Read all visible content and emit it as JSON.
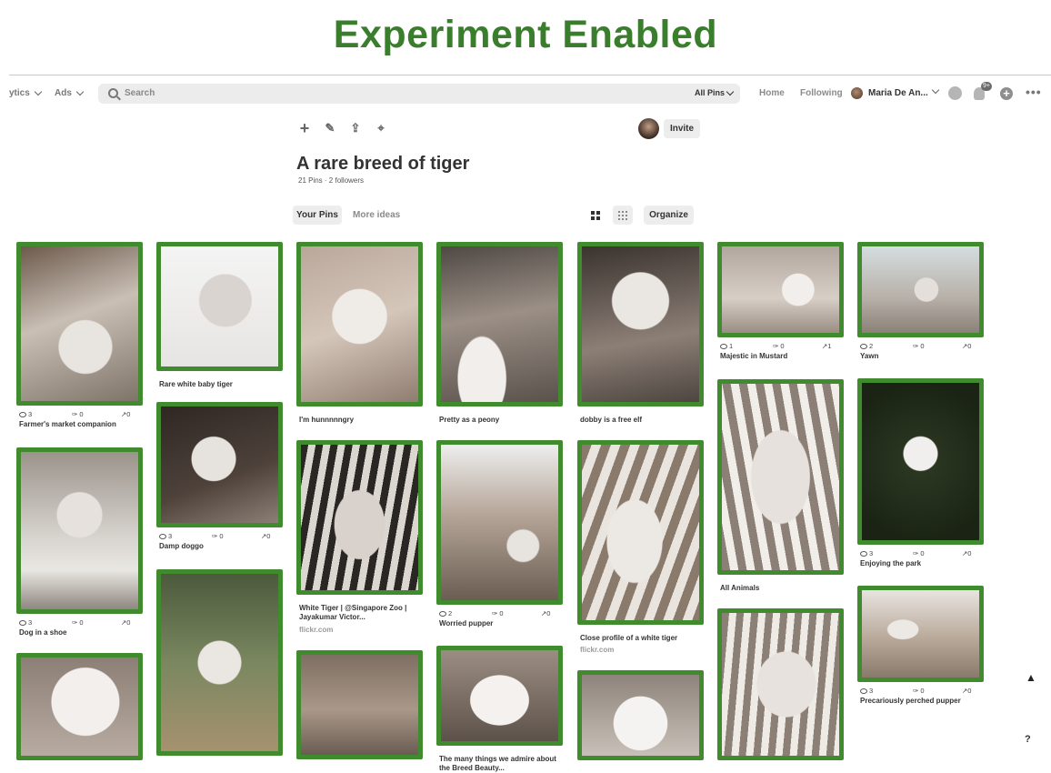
{
  "banner": {
    "title": "Experiment Enabled"
  },
  "nav": {
    "analytics_label": "ytics",
    "ads_label": "Ads",
    "search_placeholder": "Search",
    "scope_label": "All Pins",
    "home_label": "Home",
    "following_label": "Following",
    "user_name": "Maria De An...",
    "notification_count": "9+",
    "more_label": "•••"
  },
  "board": {
    "title": "A rare breed of tiger",
    "meta": "21 Pins · 2 followers",
    "invite_label": "Invite",
    "tabs": {
      "your_pins": "Your Pins",
      "more_ideas": "More ideas"
    },
    "organize_label": "Organize",
    "tools": [
      "plus-icon",
      "pencil-icon",
      "share-icon",
      "focus-icon"
    ]
  },
  "accent": "#3f8b2d",
  "pins": [
    {
      "title": "Farmer's market companion",
      "views": "3",
      "saves": "0",
      "clicks": "0",
      "image": "dog-held"
    },
    {
      "title": "Dog in a shoe",
      "views": "3",
      "saves": "0",
      "clicks": "0",
      "image": "dog-shoe"
    },
    {
      "title": "",
      "image": "dog-closeup"
    },
    {
      "title": "Rare white baby tiger",
      "image": "white-cub"
    },
    {
      "title": "Damp doggo",
      "views": "3",
      "saves": "0",
      "clicks": "0",
      "image": "dog-dark"
    },
    {
      "title": "",
      "image": "cub-grass"
    },
    {
      "title": "I'm hunnnnngry",
      "image": "dog-tiles"
    },
    {
      "title": "White Tiger | @Singapore Zoo | Jayakumar Victor...",
      "source": "flickr.com",
      "image": "tiger-face"
    },
    {
      "title": "",
      "image": "laptop"
    },
    {
      "title": "Pretty as a peony",
      "image": "dog-rocks"
    },
    {
      "title": "Worried pupper",
      "views": "2",
      "saves": "0",
      "clicks": "0",
      "image": "wagon"
    },
    {
      "title": "The many things we admire about the Breed Beauty...",
      "image": "puppies"
    },
    {
      "title": "dobby is a free elf",
      "image": "dog-blanket"
    },
    {
      "title": "Close profile of a white tiger",
      "source": "flickr.com",
      "image": "tiger-profile"
    },
    {
      "title": "",
      "image": "flower"
    },
    {
      "title": "Majestic in Mustard",
      "views": "1",
      "saves": "0",
      "clicks": "1",
      "image": "dog-bed"
    },
    {
      "title": "All Animals",
      "image": "tiger-roar"
    },
    {
      "title": "",
      "image": "tiger-sitting"
    },
    {
      "title": "Yawn",
      "views": "2",
      "saves": "0",
      "clicks": "0",
      "image": "street"
    },
    {
      "title": "Enjoying the park",
      "views": "3",
      "saves": "0",
      "clicks": "0",
      "image": "dog-park"
    },
    {
      "title": "Precariously perched pupper",
      "views": "3",
      "saves": "0",
      "clicks": "0",
      "image": "dog-couch"
    }
  ],
  "help_label": "?"
}
